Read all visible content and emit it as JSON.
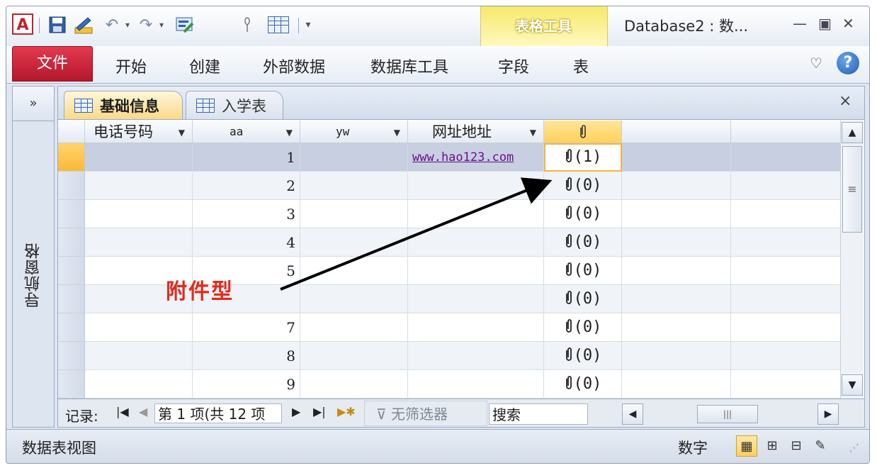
{
  "app": {
    "title": "Database2 : 数...",
    "icon_letter": "A",
    "contextual_group": "表格工具",
    "window_controls": [
      "▭",
      "▢",
      "✕"
    ]
  },
  "quick_access": {
    "save_icon": "💾",
    "undo_icon": "↶",
    "redo_icon": "↷",
    "customize_icon": "▾"
  },
  "ribbon": {
    "file_label": "文件",
    "tabs": [
      "开始",
      "创建",
      "外部数据",
      "数据库工具",
      "字段",
      "表"
    ],
    "help_label": "?"
  },
  "nav_pane": {
    "toggle_label": "»",
    "label": "导航窗格"
  },
  "doc_tabs": [
    {
      "label": "基础信息",
      "active": true
    },
    {
      "label": "入学表",
      "active": false
    }
  ],
  "doc_close": "×",
  "grid": {
    "columns": [
      {
        "label": "电话号码"
      },
      {
        "label": "aa"
      },
      {
        "label": "yw"
      },
      {
        "label": "网址地址"
      },
      {
        "label": "📎"
      }
    ],
    "rows": [
      {
        "aa": "1",
        "url": "www.hao123.com",
        "att": "(1)"
      },
      {
        "aa": "2",
        "url": "",
        "att": "(0)"
      },
      {
        "aa": "3",
        "url": "",
        "att": "(0)"
      },
      {
        "aa": "4",
        "url": "",
        "att": "(0)"
      },
      {
        "aa": "5",
        "url": "",
        "att": "(0)"
      },
      {
        "aa": "",
        "url": "",
        "att": "(0)"
      },
      {
        "aa": "7",
        "url": "",
        "att": "(0)"
      },
      {
        "aa": "8",
        "url": "",
        "att": "(0)"
      },
      {
        "aa": "9",
        "url": "",
        "att": "(0)"
      }
    ],
    "attach_glyph": "⊕"
  },
  "record_nav": {
    "label": "记录:",
    "first": "|◀",
    "prev": "◀",
    "current": "第 1 项(共 12 项",
    "next": "▶",
    "last": "▶|",
    "new": "▶✱",
    "filter_icon": "⊽",
    "filter_label": "无筛选器",
    "search_label": "搜索"
  },
  "annotation": {
    "text": "附件型"
  },
  "status": {
    "view_name": "数据表视图",
    "mode": "数字",
    "view_icons": [
      "▦",
      "⊞",
      "⊟",
      "✎"
    ]
  },
  "colors": {
    "file_tab": "#c4203a",
    "contextual": "#f7e96a",
    "annotation": "#e32b1c",
    "link": "#6a0f8e"
  }
}
